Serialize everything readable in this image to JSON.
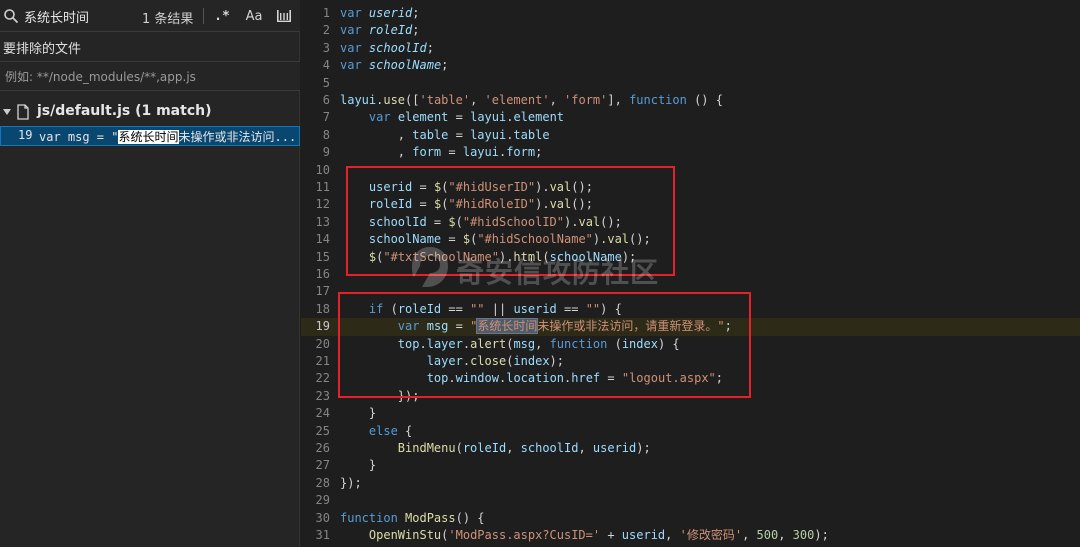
{
  "search": {
    "query": "系统长时间",
    "result_count": "1 条结果",
    "regex_label": ".*",
    "case_label": "Aa",
    "icons": [
      "search-icon",
      "regex-icon",
      "match-case-icon",
      "whole-word-icon"
    ]
  },
  "exclude": {
    "label": "要排除的文件",
    "placeholder": "例如: **/node_modules/**,app.js"
  },
  "results": {
    "file": "js/default.js (1 match)",
    "match": {
      "line_no": "19",
      "prefix": "var msg = \"",
      "highlight": "系统长时间",
      "suffix": "未操作或非法访问..."
    }
  },
  "editor": {
    "lines": [
      {
        "n": "1"
      },
      {
        "n": "2"
      },
      {
        "n": "3"
      },
      {
        "n": "4"
      },
      {
        "n": "5"
      },
      {
        "n": "6"
      },
      {
        "n": "7"
      },
      {
        "n": "8"
      },
      {
        "n": "9"
      },
      {
        "n": "10"
      },
      {
        "n": "11"
      },
      {
        "n": "12"
      },
      {
        "n": "13"
      },
      {
        "n": "14"
      },
      {
        "n": "15"
      },
      {
        "n": "16"
      },
      {
        "n": "17"
      },
      {
        "n": "18"
      },
      {
        "n": "19"
      },
      {
        "n": "20"
      },
      {
        "n": "21"
      },
      {
        "n": "22"
      },
      {
        "n": "23"
      },
      {
        "n": "24"
      },
      {
        "n": "25"
      },
      {
        "n": "26"
      },
      {
        "n": "27"
      },
      {
        "n": "28"
      },
      {
        "n": "29"
      },
      {
        "n": "30"
      },
      {
        "n": "31"
      }
    ],
    "current_line": "19"
  },
  "watermark": {
    "text": "奇安信攻防社区"
  },
  "colors": {
    "background": "#1e1e1e",
    "panel": "#252526",
    "keyword": "#569cd6",
    "string": "#ce9178",
    "function": "#dcdcaa",
    "variable": "#9cdcfe",
    "annotation_box": "#e5222a",
    "selection": "#094771"
  }
}
